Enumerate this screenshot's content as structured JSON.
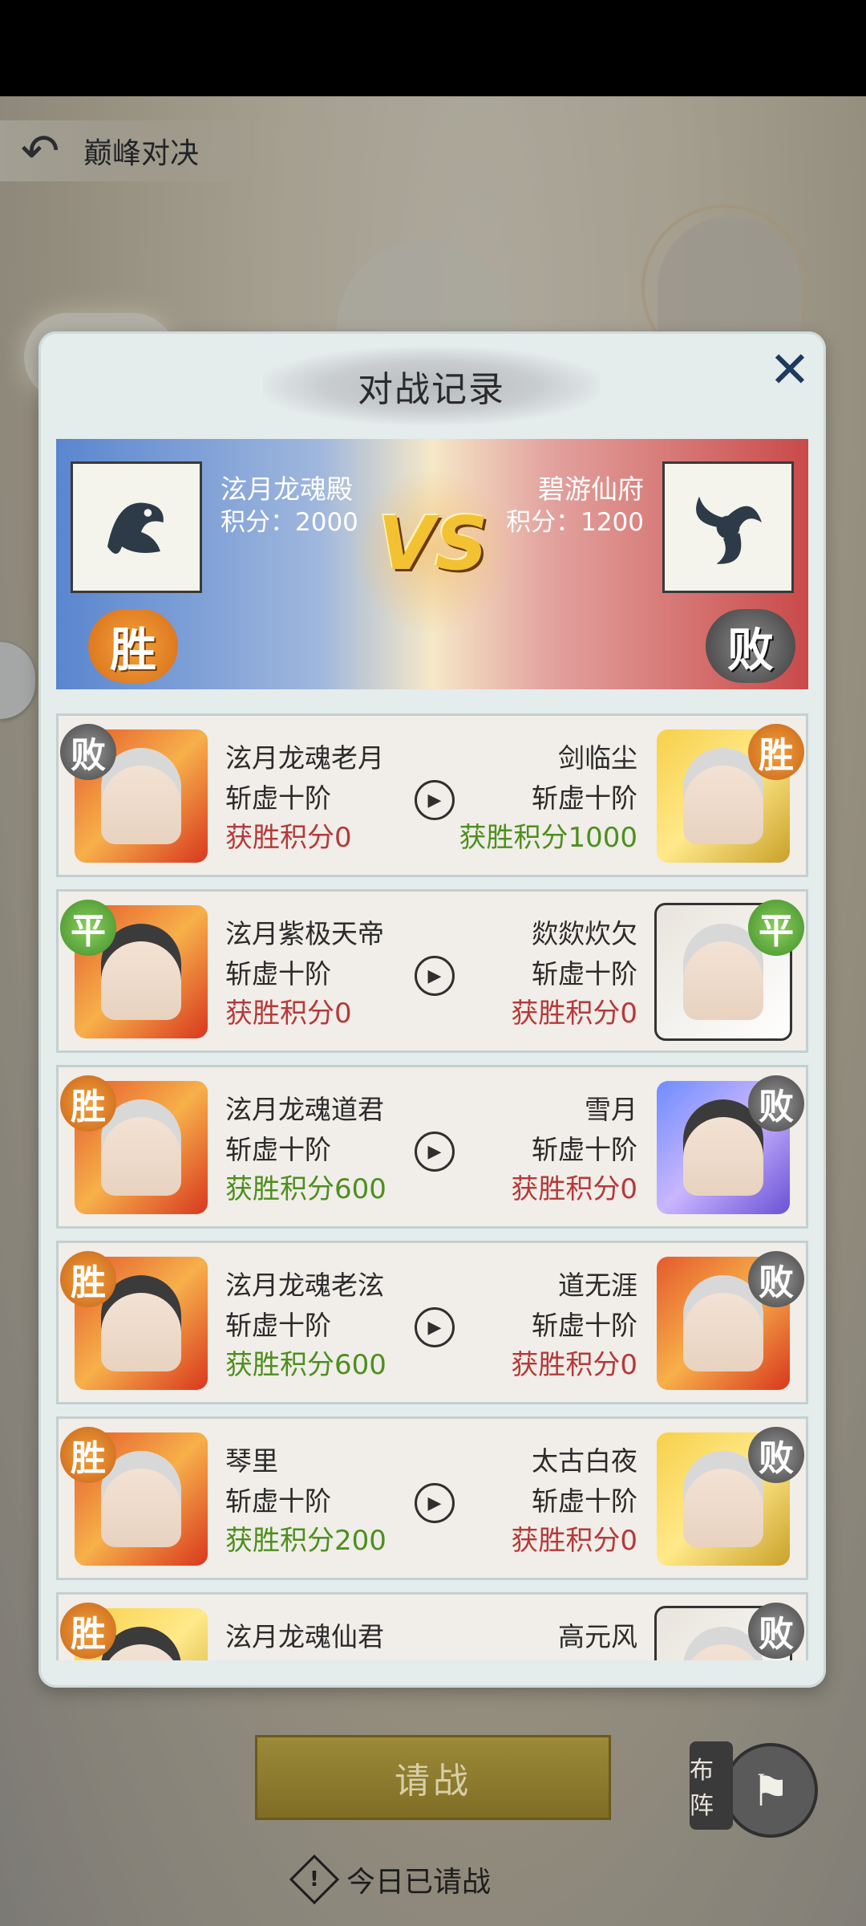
{
  "screen": {
    "title": "巅峰对决"
  },
  "panel": {
    "title": "对战记录",
    "close_icon": "close-icon",
    "left_team": {
      "name": "泫月龙魂殿",
      "score_label": "积分：2000",
      "result": "胜"
    },
    "right_team": {
      "name": "碧游仙府",
      "score_label": "积分：1200",
      "result": "败"
    },
    "vs": "VS"
  },
  "records": [
    {
      "left": {
        "name": "泫月龙魂老月",
        "rank": "斩虚十阶",
        "score": "获胜积分0",
        "result": "败"
      },
      "right": {
        "name": "剑临尘",
        "rank": "斩虚十阶",
        "score": "获胜积分1000",
        "result": "胜"
      }
    },
    {
      "left": {
        "name": "泫月紫极天帝",
        "rank": "斩虚十阶",
        "score": "获胜积分0",
        "result": "平"
      },
      "right": {
        "name": "欻欻炊欠",
        "rank": "斩虚十阶",
        "score": "获胜积分0",
        "result": "平"
      }
    },
    {
      "left": {
        "name": "泫月龙魂道君",
        "rank": "斩虚十阶",
        "score": "获胜积分600",
        "result": "胜"
      },
      "right": {
        "name": "雪月",
        "rank": "斩虚十阶",
        "score": "获胜积分0",
        "result": "败"
      }
    },
    {
      "left": {
        "name": "泫月龙魂老泫",
        "rank": "斩虚十阶",
        "score": "获胜积分600",
        "result": "胜"
      },
      "right": {
        "name": "道无涯",
        "rank": "斩虚十阶",
        "score": "获胜积分0",
        "result": "败"
      }
    },
    {
      "left": {
        "name": "琴里",
        "rank": "斩虚十阶",
        "score": "获胜积分200",
        "result": "胜"
      },
      "right": {
        "name": "太古白夜",
        "rank": "斩虚十阶",
        "score": "获胜积分0",
        "result": "败"
      }
    },
    {
      "left": {
        "name": "泫月龙魂仙君",
        "rank": "",
        "score": "",
        "result": "胜"
      },
      "right": {
        "name": "高元风",
        "rank": "",
        "score": "",
        "result": "败"
      }
    }
  ],
  "footer": {
    "challenge_label": "请战",
    "formation_label": "布阵",
    "status_text": "今日已请战"
  },
  "colors": {
    "win_score": "#4d8f1e",
    "lose_score": "#b43a3a"
  }
}
